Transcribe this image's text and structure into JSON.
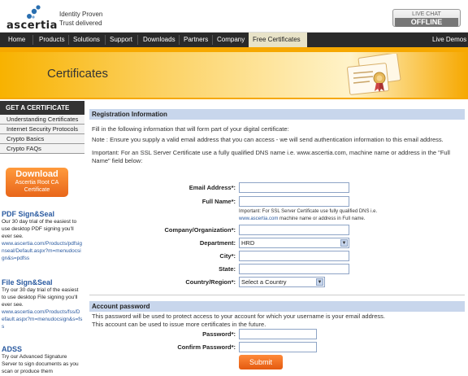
{
  "header": {
    "logo_text": "ascertia",
    "tagline_1": "Identity Proven",
    "tagline_2": "Trust delivered",
    "live_chat_label": "LIVE CHAT",
    "live_chat_status": "OFFLINE"
  },
  "nav": {
    "items": [
      "Home",
      "Products",
      "Solutions",
      "Support",
      "Downloads",
      "Partners",
      "Company",
      "Free Certificates"
    ],
    "right_link": "Live Demos",
    "active": "Free Certificates"
  },
  "banner": {
    "title": "Certificates"
  },
  "sidebar": {
    "heading": "GET A CERTIFICATE",
    "items": [
      "Understanding Certificates",
      "Internet Security Protocols",
      "Crypto Basics",
      "Crypto FAQs"
    ],
    "download": {
      "line1": "Download",
      "line2": "Ascertia Root CA",
      "line3": "Certificate"
    },
    "promos": [
      {
        "title": "PDF Sign&Seal",
        "body": "Our 30 day trial of the easiest to use desktop PDF signing you'll ever see.",
        "link": "www.ascertia.com/Products/pdfsignseal/Default.aspx?m=menudocsign&s=pdfss"
      },
      {
        "title": "File Sign&Seal",
        "body": "Try our 30 day trial of the easiest to use desktop File signing you'll ever see.",
        "link": "www.ascertia.com/Products/fss/Default.aspx?m=menudocsign&s=fss"
      },
      {
        "title": "ADSS",
        "body": "Try our Advanced Signature Server to sign documents as you scan or produce them",
        "link": ""
      }
    ]
  },
  "registration": {
    "heading": "Registration Information",
    "intro": "Fill in the following information that will form part of your digital certificate:",
    "note": "Note : Ensure you supply a valid email address that you can access - we will send authentication information to this email address.",
    "important": "Important: For an SSL Server Certificate use a fully qualified DNS name i.e. www.ascertia.com, machine name or address in the \"Full Name\" field below:",
    "fields": {
      "email_label": "Email Address*:",
      "email_value": "",
      "fullname_label": "Full Name*:",
      "fullname_value": "",
      "fullname_note_1": "Important: For SSL Server Certificate use fully qualified DNS i.e.",
      "fullname_note_link": "www.ascertia.com",
      "fullname_note_2": " machine name or address in Full name.",
      "company_label": "Company/Organization*:",
      "company_value": "",
      "department_label": "Department:",
      "department_value": "HRD",
      "city_label": "City*:",
      "city_value": "",
      "state_label": "State:",
      "state_value": "",
      "country_label": "Country/Region*:",
      "country_value": "Select a Country"
    }
  },
  "account": {
    "heading": "Account password",
    "desc_1": "This password will be used to protect access to your account for which your username is your email address.",
    "desc_2": "This account can be used to issue more certificates in the future.",
    "password_label": "Password*:",
    "password_value": "",
    "confirm_label": "Confirm Password*:",
    "confirm_value": "",
    "submit_label": "Submit"
  },
  "colors": {
    "nav_bg": "#2a2a2a",
    "banner_orange": "#f6a800",
    "section_head": "#c8d6ec",
    "link_blue": "#2a5aa0",
    "button_orange": "#e8661a"
  }
}
